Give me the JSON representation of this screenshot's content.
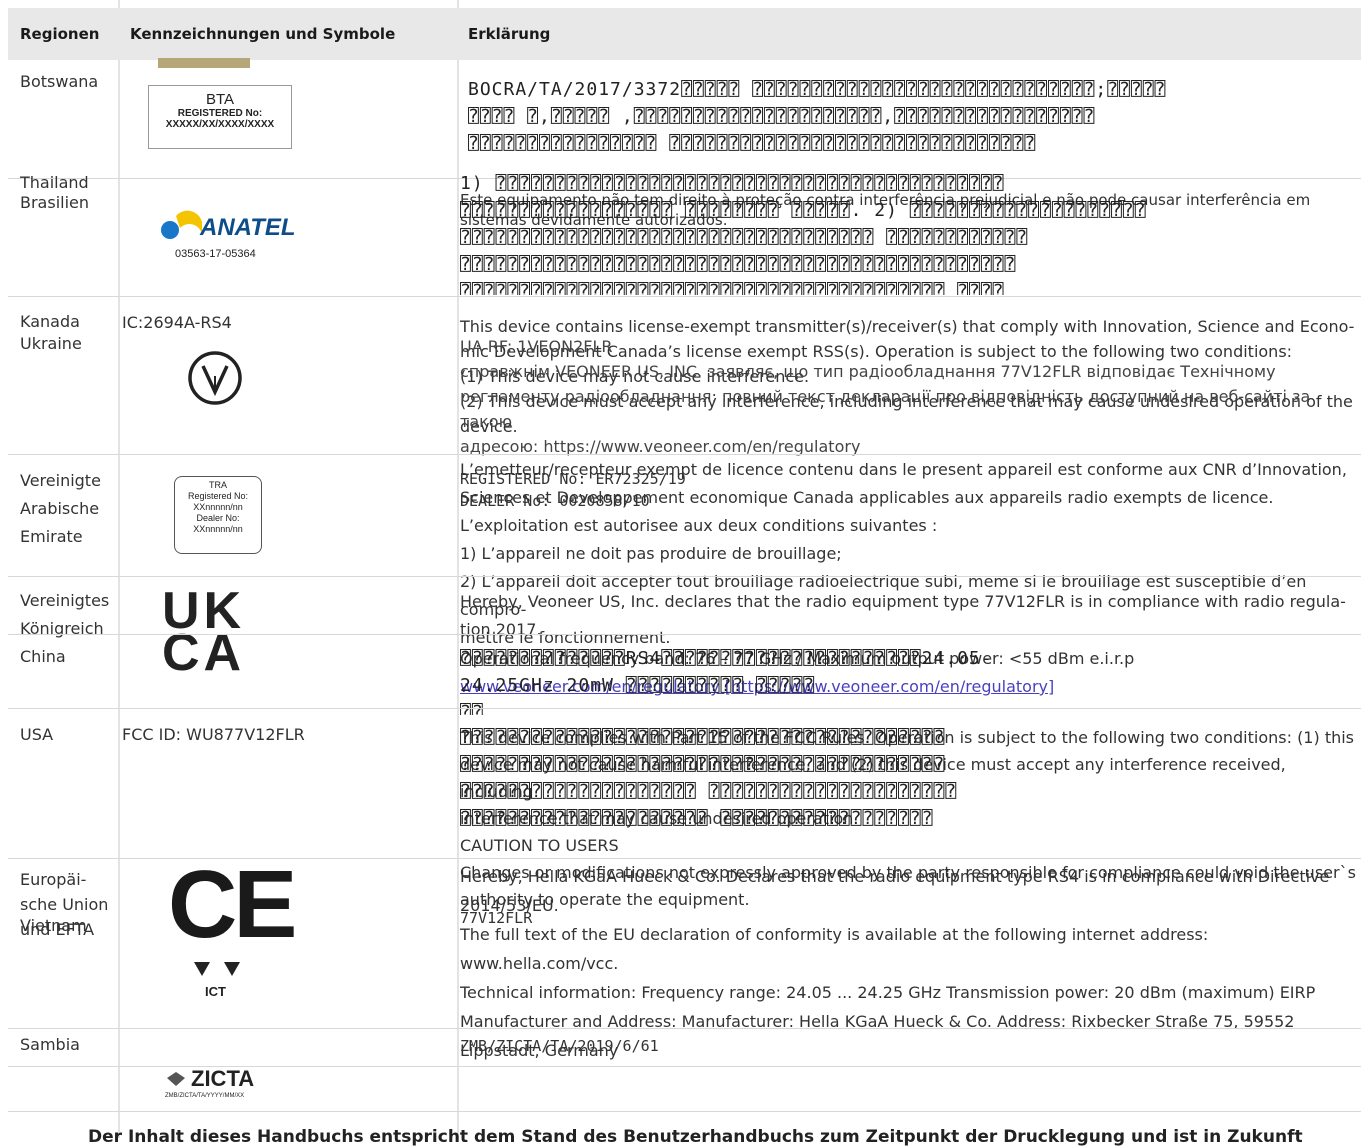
{
  "header": {
    "col_regions": "Regionen",
    "col_marks": "Kennzeichnungen und Symbole",
    "col_explanation": "Erklärung"
  },
  "rows": {
    "botswana": {
      "region": "Botswana",
      "label_title": "BTA",
      "label_reg": "REGISTERED No:",
      "label_num": "XXXXX/XX/XXXX/XXXX",
      "expl_code": "BOCRA/TA/2017/3372",
      "expl_garbled_1": "⍰⍰⍰⍰⍰ ⍰⍰⍰⍰⍰⍰⍰⍰⍰⍰⍰⍰⍰⍰⍰⍰⍰⍰⍰⍰⍰⍰⍰⍰⍰⍰⍰⍰⍰;⍰⍰⍰⍰⍰",
      "expl_garbled_2": "⍰⍰⍰⍰ ⍰,⍰⍰⍰⍰⍰ ,⍰⍰⍰⍰⍰⍰⍰⍰⍰⍰⍰⍰⍰⍰⍰⍰⍰⍰⍰⍰⍰,⍰⍰⍰⍰⍰⍰⍰⍰⍰⍰⍰⍰⍰⍰⍰⍰⍰",
      "expl_garbled_3": "⍰⍰⍰⍰⍰⍰⍰⍰⍰⍰⍰⍰⍰⍰⍰⍰ ⍰⍰⍰⍰⍰⍰⍰⍰⍰⍰⍰⍰⍰⍰⍰⍰⍰⍰⍰⍰⍰⍰⍰⍰⍰⍰⍰⍰⍰⍰⍰"
    },
    "thailand": {
      "region_1": "Thailand",
      "region_2": "Brasilien",
      "anatel_word": "ANATEL",
      "anatel_num": "03563-17-05364",
      "expl_pt": "Este equipamento não tem direito à proteção contra interferência prejudicial e não pode causar interferência em sistemas devidamente autorizados.",
      "expl_garbled_1": "1) ⍰⍰⍰⍰⍰⍰⍰⍰⍰⍰⍰⍰⍰⍰⍰⍰⍰⍰⍰⍰⍰⍰⍰⍰⍰⍰⍰⍰⍰⍰⍰⍰⍰⍰⍰⍰⍰⍰⍰⍰⍰⍰⍰",
      "expl_garbled_2": "⍰⍰⍰⍰⍰⍰⍰⍰⍰⍰⍰⍰⍰⍰⍰⍰⍰⍰ ⍰⍰⍰⍰⍰⍰⍰⍰ ⍰⍰⍰⍰⍰. 2) ⍰⍰⍰⍰⍰⍰⍰⍰⍰⍰⍰⍰⍰⍰⍰⍰⍰⍰⍰⍰",
      "expl_garbled_3": "⍰⍰⍰⍰⍰⍰⍰⍰⍰⍰⍰⍰⍰⍰⍰⍰⍰⍰⍰⍰⍰⍰⍰⍰⍰⍰⍰⍰⍰⍰⍰⍰⍰⍰⍰ ⍰⍰⍰⍰⍰⍰⍰⍰⍰⍰⍰⍰",
      "expl_garbled_4": "⍰⍰⍰⍰⍰⍰⍰⍰⍰⍰⍰⍰⍰⍰⍰⍰⍰⍰⍰⍰⍰⍰⍰⍰⍰⍰⍰⍰⍰⍰⍰⍰⍰⍰⍰⍰⍰⍰⍰⍰⍰⍰⍰⍰⍰⍰⍰",
      "expl_garbled_5": "⍰⍰⍰⍰⍰⍰⍰⍰⍰⍰⍰⍰⍰⍰⍰⍰⍰⍰⍰⍰⍰⍰⍰⍰⍰⍰⍰⍰⍰⍰⍰⍰⍰⍰⍰⍰⍰⍰⍰⍰⍰ ⍰⍰⍰⍰"
    },
    "kanada": {
      "region_1": "Kanada",
      "region_2": "Ukraine",
      "mark_text": "IC:2694A-RS4",
      "uarf": "UA RF: 1VEON2FLR",
      "expl_1": "This device contains license-exempt transmitter(s)/receiver(s) that comply with Innovation, Science and Econo-",
      "expl_2": "mic Development Canada’s license exempt RSS(s). Operation is subject to the following two conditions:",
      "expl_3": "(1) This device may not cause interference.",
      "expl_4": "(2) This device must accept any interference, including interference that may cause undesired operation of the device.",
      "expl_ua_1": "справжнім VEONEER US, INC. заявляє, що тип радіообладнання 77V12FLR відповідає Технічному",
      "expl_ua_2": "регламенту радіообладнання; повний текст декларації про відповідність доступний на веб-сайті за такою",
      "expl_ua_3": "адресою: https://www.veoneer.com/en/regulatory"
    },
    "uae": {
      "region_1": "Vereinigte",
      "region_2": "Arabische",
      "region_3": "Emirate",
      "tra_title": "TRA",
      "tra_reg": "Registered No:",
      "tra_num": "XXnnnnn/nn",
      "tra_dealer": "Dealer No:",
      "tra_dnum": "XXnnnnn/nn",
      "reg_no": "REGISTERED No: ER72325/19",
      "dealer_no": "DEALER No: 0020858/10",
      "expl_fr_1": "L’emetteur/recepteur exempt de licence contenu dans le present appareil est conforme aux CNR d’Innovation,",
      "expl_fr_2": "Sciences et Developpement economique Canada applicables aux appareils radio exempts de licence.",
      "expl_fr_3": "L’exploitation est autorisee aux deux conditions suivantes :",
      "expl_fr_4": "1) L’appareil ne doit pas produire de brouillage;",
      "expl_fr_5": "2) L’appareil doit accepter tout brouillage radioelectrique subi, meme si le brouillage est susceptible d’en compro-",
      "expl_fr_6": "mettre le fonctionnement."
    },
    "uk": {
      "region_1": "Vereinigtes",
      "region_2": "Königreich",
      "ukca_top": "UK",
      "ukca_bottom": "CA",
      "expl_1": "Hereby, Veoneer US, Inc. declares that the radio equipment type 77V12FLR is in compliance with radio regula-",
      "expl_2": "tion 2017."
    },
    "china": {
      "region": "China",
      "expl_1": "Operational frequency band: 76 – 77 GHz / Maximum output power: <55 dBm e.i.r.p",
      "expl_garbled_1": "⍰⍰⍰⍰⍰⍰⍰⍰⍰⍰⍰⍰⍰⍰RS4⍰⍰⍰⍰⍰⍰⍰⍰⍰⍰⍰⍰⍰⍰⍰⍰⍰⍰⍰⍰⍰⍰24.05-",
      "expl_2": "24.25GHz",
      "expl_3": "20mW",
      "link_text": "www.veoneer.com/en/regulatory [https://www.veoneer.com/en/regulatory]",
      "expl_garbled_2": "⍰⍰⍰⍰⍰⍰⍰⍰⍰⍰ ⍰⍰⍰⍰⍰",
      "expl_garbled_3": "⍰⍰"
    },
    "usa": {
      "region": "USA",
      "mark_text": "FCC ID: WU877V12FLR",
      "expl_1": "This device complies with Part 15 of the FCC Rules. Operation is subject to the following two conditions: (1) this",
      "expl_2": "device may not cause harmful interference, and (2) this device must accept any interference received, including",
      "expl_3": "interference that may cause undesired operation.",
      "expl_4": "CAUTION TO USERS",
      "expl_5": "Changes or modifications not expressly approved by the party responsible for compliance could void the user`s",
      "expl_6": "authority to operate the equipment.",
      "expl_garbled_1": "⍰⍰⍰⍰⍰⍰⍰⍰⍰⍰⍰⍰⍰⍰⍰⍰⍰⍰⍰⍰⍰⍰⍰⍰⍰⍰⍰⍰⍰⍰⍰⍰⍰⍰⍰⍰⍰⍰⍰⍰⍰",
      "expl_garbled_2": "⍰⍰⍰⍰⍰⍰⍰⍰⍰⍰⍰⍰⍰⍰⍰⍰⍰⍰⍰⍰⍰⍰⍰⍰⍰⍰⍰⍰⍰⍰⍰⍰⍰⍰⍰⍰⍰⍰⍰⍰⍰",
      "expl_garbled_3": "⍰⍰⍰⍰⍰⍰⍰⍰⍰⍰⍰⍰⍰⍰⍰⍰⍰⍰⍰⍰ ⍰⍰⍰⍰⍰⍰⍰⍰⍰⍰⍰⍰⍰⍰⍰⍰⍰⍰⍰⍰⍰",
      "expl_garbled_4": "⍰⍰⍰⍰⍰⍰⍰⍰⍰⍰⍰⍰⍰⍰⍰⍰⍰⍰⍰⍰⍰ ⍰⍰⍰⍰⍰⍰⍰⍰⍰⍰⍰⍰⍰⍰⍰⍰⍰⍰"
    },
    "eu": {
      "region_1": "Europäi-",
      "region_2": "sche Union",
      "region_3": "und EFTA",
      "region_vn": "Vietnam",
      "ce_mark": "CE",
      "ict_mark": "ICT",
      "vn_model": "77V12FLR",
      "expl_1": "Hereby, Hella KGaA Hueck & Co. Declares that the radio equipment type RS4 is in compliance with Directive",
      "expl_2": "2014/53/EU.",
      "expl_3": "The full text of the EU declaration of conformity is available at the following internet address:",
      "expl_4": "www.hella.com/vcc.",
      "expl_5": "Technical information: Frequency range: 24.05 ... 24.25 GHz Transmission power: 20 dBm (maximum) EIRP",
      "expl_6": "Manufacturer and Address: Manufacturer: Hella KGaA Hueck & Co. Address: Rixbecker Straße 75, 59552",
      "expl_7": "Lippstadt, Germany"
    },
    "sambia": {
      "region": "Sambia",
      "expl_1": "ZMB/ZICTA/TA/2019/6/61",
      "zicta_word": "ZICTA",
      "zicta_sub": "ZMB/ZICTA/TA/YYYY/MM/XX"
    }
  },
  "footer": {
    "text": "Der Inhalt dieses Handbuchs entspricht dem Stand des Benutzerhandbuchs zum Zeitpunkt der Drucklegung und ist in Zukunft"
  }
}
